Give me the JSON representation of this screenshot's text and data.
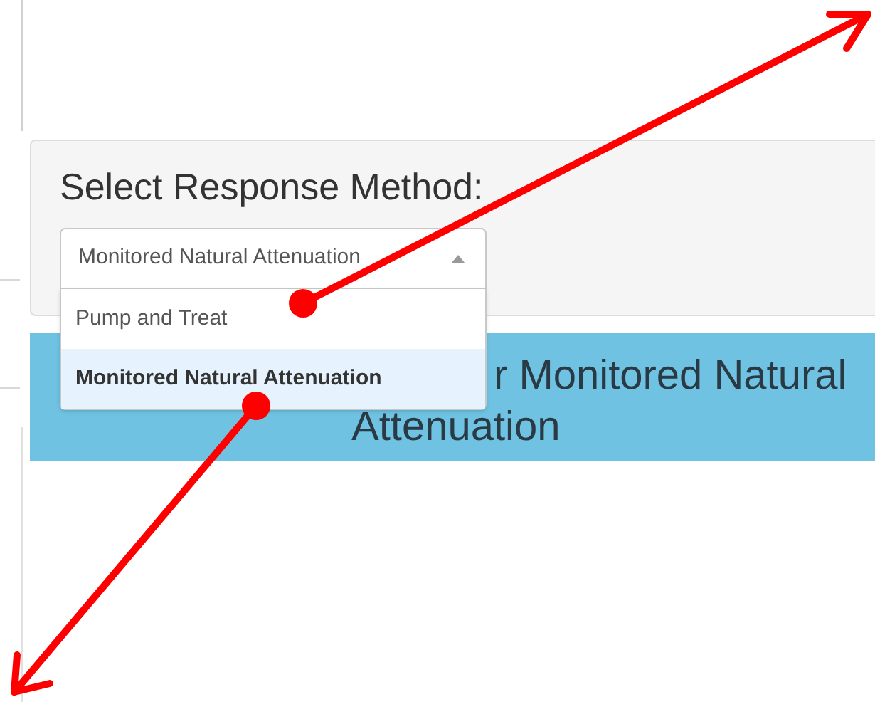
{
  "panel": {
    "label": "Select Response Method:",
    "select": {
      "value": "Monitored Natural Attenuation",
      "expanded": true,
      "options": [
        {
          "label": "Pump and Treat",
          "selected": false
        },
        {
          "label": "Monitored Natural Attenuation",
          "selected": true
        }
      ]
    }
  },
  "banner": {
    "lines": [
      "r Monitored Natural",
      "Attenuation"
    ]
  }
}
